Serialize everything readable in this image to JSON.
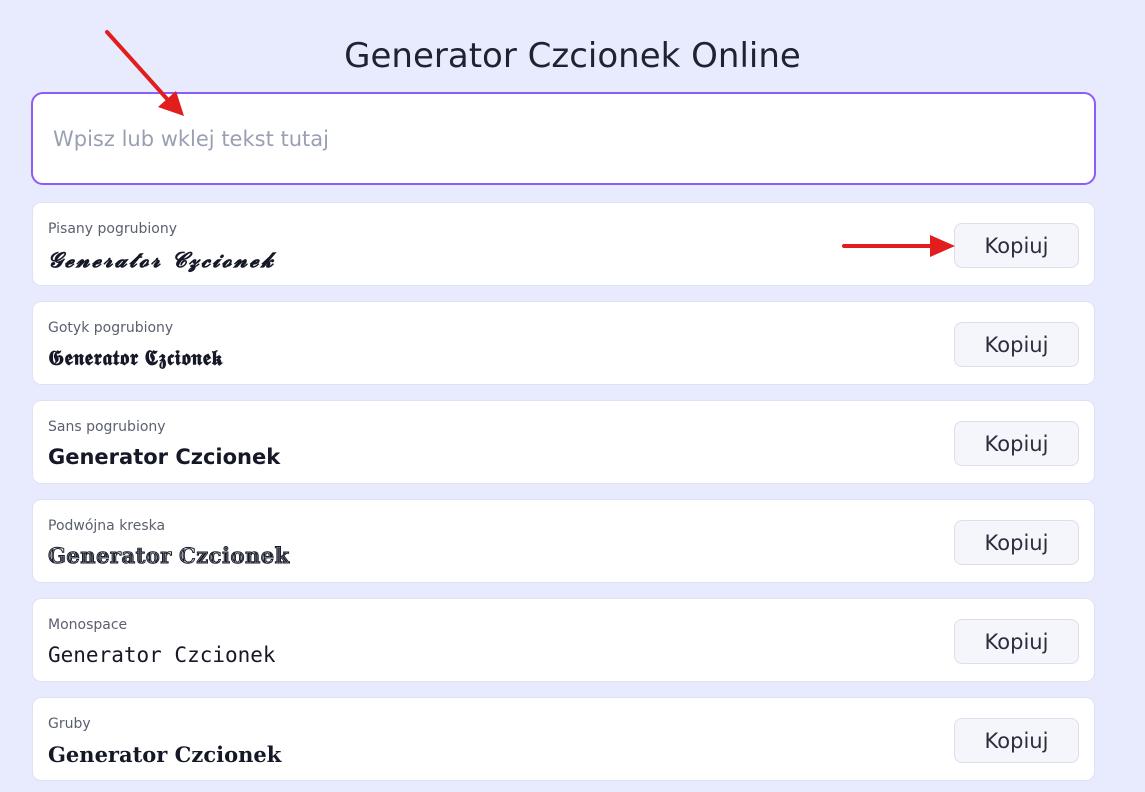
{
  "header": {
    "title": "Generator Czcionek Online"
  },
  "input": {
    "placeholder": "Wpisz lub wklej tekst tutaj",
    "value": ""
  },
  "copy_label": "Kopiuj",
  "styles": [
    {
      "label": "Pisany pogrubiony",
      "sample": "𝓖𝓮𝓷𝓮𝓻𝓪𝓽𝓸𝓻 𝓒𝔃𝓬𝓲𝓸𝓷𝓮𝓴"
    },
    {
      "label": "Gotyk pogrubiony",
      "sample": "𝕲𝖊𝖓𝖊𝖗𝖆𝖙𝖔𝖗 𝕮𝖟𝖈𝖎𝖔𝖓𝖊𝖐"
    },
    {
      "label": "Sans pogrubiony",
      "sample": "𝗚𝗲𝗻𝗲𝗿𝗮𝘁𝗼𝗿 𝗖𝘇𝗰𝗶𝗼𝗻𝗲𝗸"
    },
    {
      "label": "Podwójna kreska",
      "sample": "𝔾𝕖𝕟𝕖𝕣𝕒𝕥𝕠𝕣 ℂ𝕫𝕔𝕚𝕠𝕟𝕖𝕜"
    },
    {
      "label": "Monospace",
      "sample": "𝙶𝚎𝚗𝚎𝚛𝚊𝚝𝚘𝚛 𝙲𝚣𝚌𝚒𝚘𝚗𝚎𝚔"
    },
    {
      "label": "Gruby",
      "sample": "𝐆𝐞𝐧𝐞𝐫𝐚𝐭𝐨𝐫 𝐂𝐳𝐜𝐢𝐨𝐧𝐞𝐤"
    }
  ],
  "colors": {
    "background": "#e8ebfd",
    "accent": "#8b5cf6",
    "annotation_arrow": "#e11d1d"
  },
  "icons": {
    "annotation": "red-arrow-icon"
  }
}
